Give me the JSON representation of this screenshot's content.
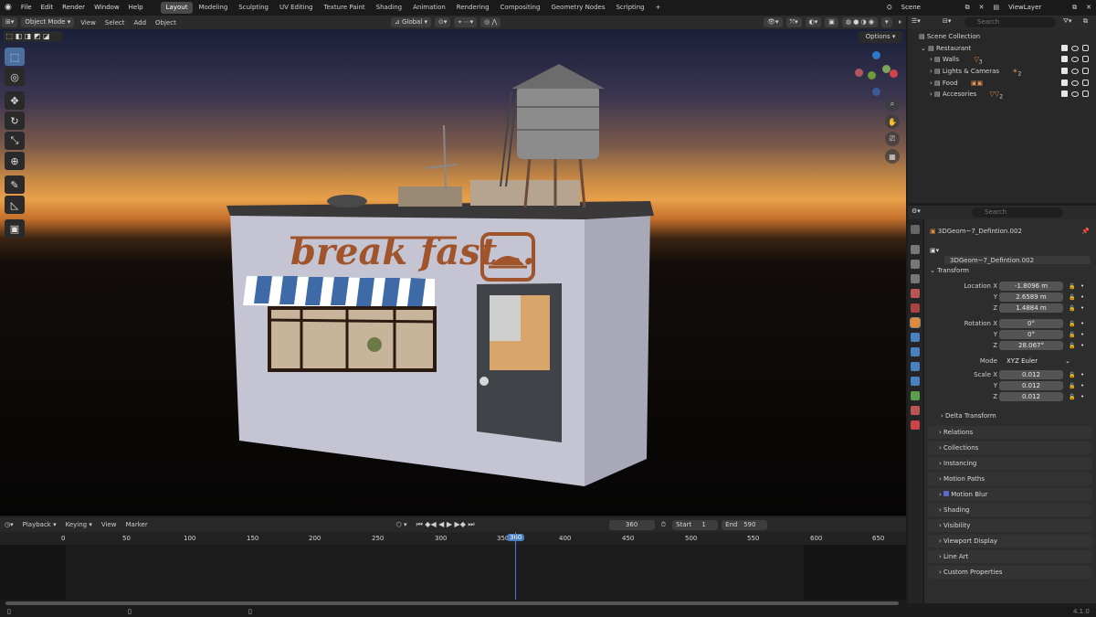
{
  "menu": [
    "File",
    "Edit",
    "Render",
    "Window",
    "Help"
  ],
  "workspaces": [
    {
      "label": "Layout",
      "active": true
    },
    {
      "label": "Modeling"
    },
    {
      "label": "Sculpting"
    },
    {
      "label": "UV Editing"
    },
    {
      "label": "Texture Paint"
    },
    {
      "label": "Shading"
    },
    {
      "label": "Animation"
    },
    {
      "label": "Rendering"
    },
    {
      "label": "Compositing"
    },
    {
      "label": "Geometry Nodes"
    },
    {
      "label": "Scripting"
    }
  ],
  "add_tab": "+",
  "scene_name": "Scene",
  "view_layer": "ViewLayer",
  "viewport_header": {
    "mode": "Object Mode",
    "menus": [
      "View",
      "Select",
      "Add",
      "Object"
    ],
    "transform_orientation": "Global",
    "options": "Options"
  },
  "scene": {
    "sign_text": "break fast..."
  },
  "timeline": {
    "menus": [
      "Playback",
      "Keying",
      "View",
      "Marker"
    ],
    "current_frame": "360",
    "start_label": "Start",
    "start": "1",
    "end_label": "End",
    "end": "590",
    "ruler_ticks": [
      "0",
      "50",
      "100",
      "150",
      "200",
      "250",
      "300",
      "350",
      "400",
      "450",
      "500",
      "550",
      "600",
      "650"
    ],
    "playhead_label": "360"
  },
  "outliner": {
    "search_placeholder": "Search",
    "root": "Scene Collection",
    "collection": "Restaurant",
    "items": [
      {
        "label": "Walls",
        "count": "3"
      },
      {
        "label": "Lights & Cameras",
        "count": "2"
      },
      {
        "label": "Food",
        "count": ""
      },
      {
        "label": "Accesories",
        "count": "2"
      }
    ]
  },
  "properties": {
    "search_placeholder": "Search",
    "object_name": "3DGeom~7_Defintion.002",
    "data_name": "3DGeom~7_Defintion.002",
    "transform_label": "Transform",
    "location": {
      "label": "Location X",
      "x": "-1.8096 m",
      "y": "2.6589 m",
      "z": "1.4884 m"
    },
    "rotation": {
      "label": "Rotation X",
      "x": "0°",
      "y": "0°",
      "z": "28.067°"
    },
    "mode_label": "Mode",
    "mode_value": "XYZ Euler",
    "scale": {
      "label": "Scale X",
      "x": "0.012",
      "y": "0.012",
      "z": "0.012"
    },
    "axis_y": "Y",
    "axis_z": "Z",
    "delta_transform": "Delta Transform",
    "panels": [
      "Relations",
      "Collections",
      "Instancing",
      "Motion Paths",
      "Motion Blur",
      "Shading",
      "Visibility",
      "Viewport Display",
      "Line Art",
      "Custom Properties"
    ]
  },
  "version": "4.1.0"
}
